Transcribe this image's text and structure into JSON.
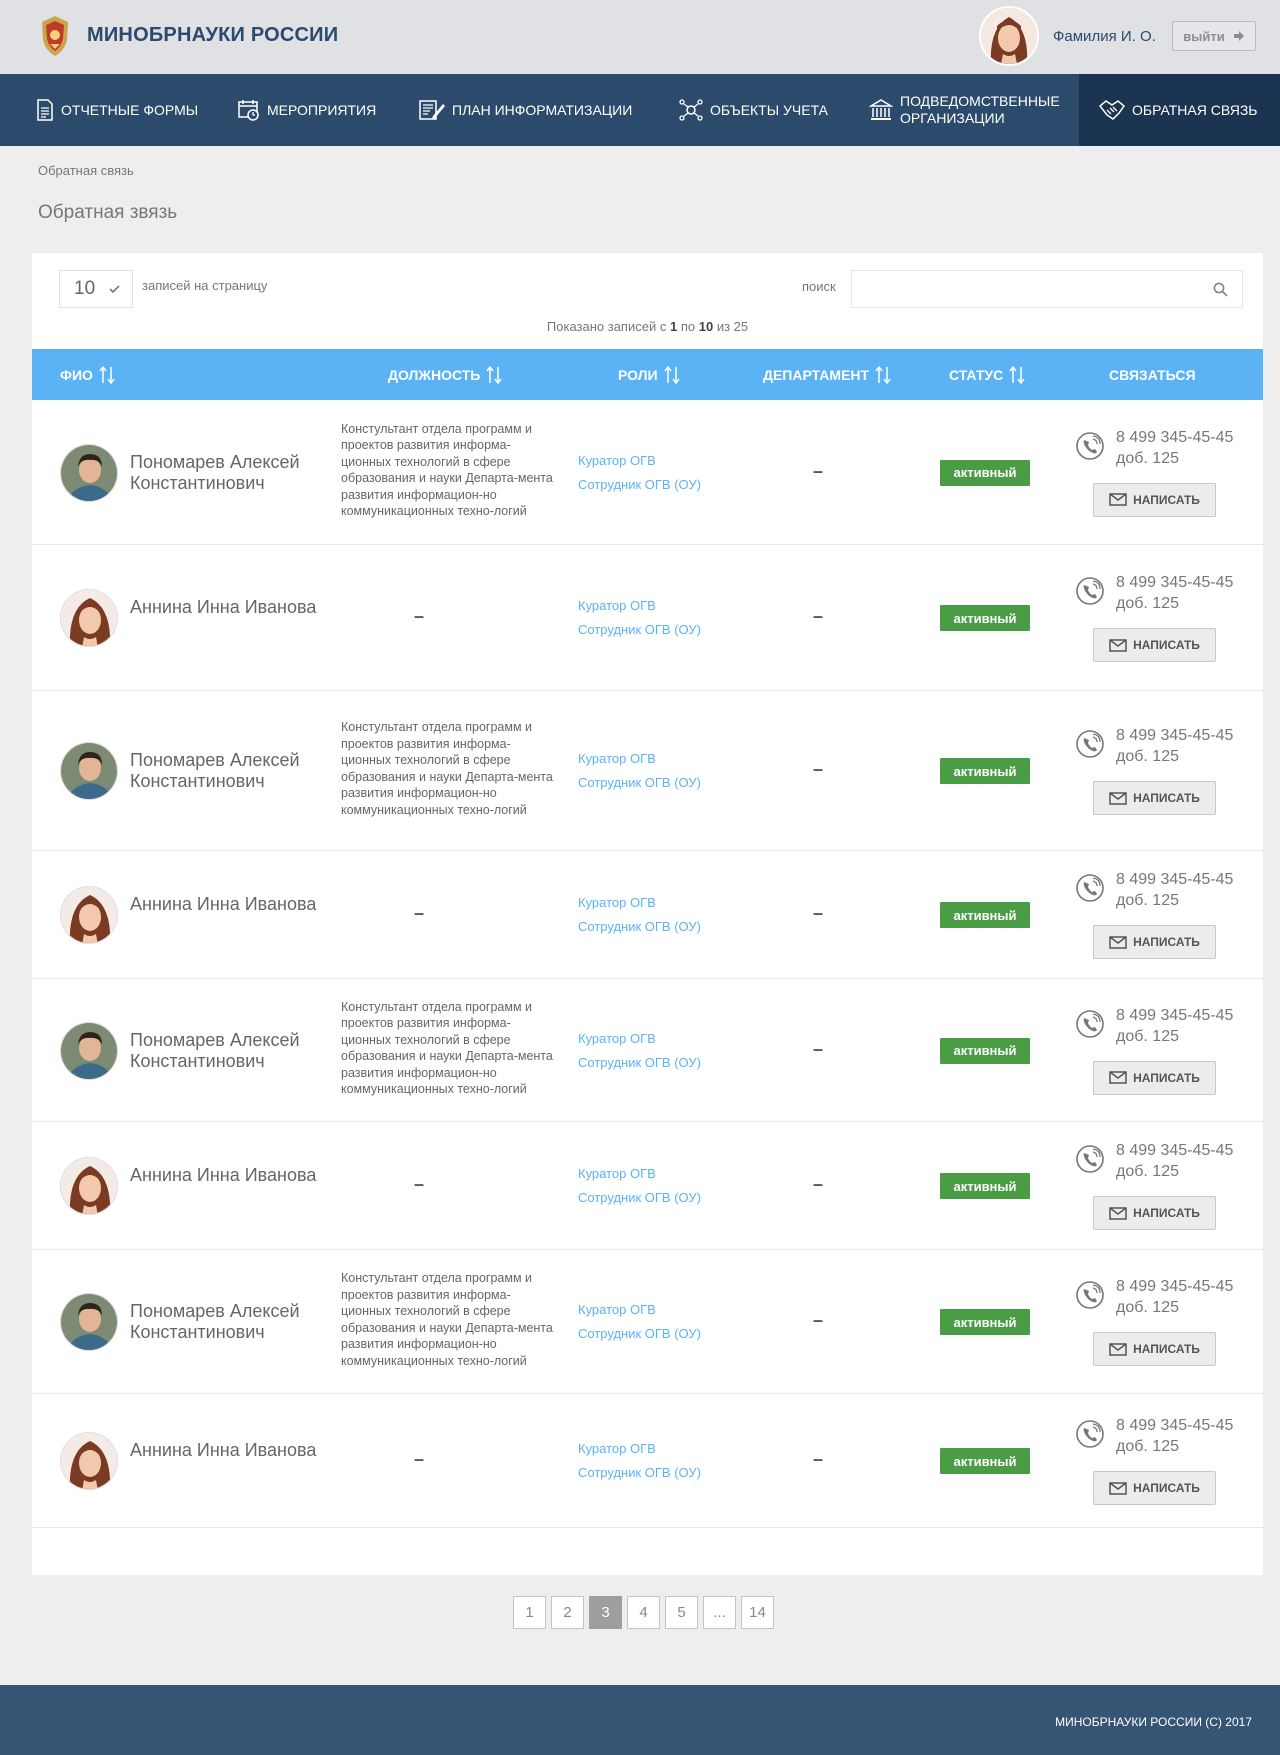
{
  "header": {
    "brand": "МИНОБРНАУКИ РОССИИ",
    "user_name": "Фамилия И. О.",
    "logout_label": "выйти"
  },
  "nav": [
    {
      "label": "ОТЧЕТНЫЕ ФОРМЫ",
      "icon": "document-icon"
    },
    {
      "label": "МЕРОПРИЯТИЯ",
      "icon": "calendar-clock-icon"
    },
    {
      "label": "ПЛАН ИНФОРМАТИЗАЦИИ",
      "icon": "plan-edit-icon"
    },
    {
      "label": "ОБЪЕКТЫ УЧЕТА",
      "icon": "network-icon"
    },
    {
      "label": "ПОДВЕДОМСТВЕННЫЕ ОРГАНИЗАЦИИ",
      "icon": "bank-icon"
    },
    {
      "label": "ОБРАТНАЯ СВЯЗЬ",
      "icon": "handshake-icon",
      "active": true
    }
  ],
  "breadcrumb": "Обратная связь",
  "page_title": "Обратная звязь",
  "table_controls": {
    "per_page": "10",
    "per_page_label": "записей на страницу",
    "search_label": "поиск",
    "search_value": "",
    "shown_prefix": "Показано записей с",
    "shown_from": "1",
    "shown_mid": "по",
    "shown_to": "10",
    "shown_of": "из 25"
  },
  "columns": [
    "ФИО",
    "ДОЛЖНОСТЬ",
    "РОЛИ",
    "ДЕПАРТАМЕНТ",
    "СТАТУС",
    "СВЯЗАТЬСЯ"
  ],
  "rows": [
    {
      "name": "Пономарев Алексей Константинович",
      "gender": "m",
      "position": "Констультант отдела программ и проектов развития информа-ционных технологий в сфере образования и науки Департа-мента развития информацион-но  коммуникационных техно-логий",
      "role1": "Куратор ОГВ",
      "role2": "Сотрудник ОГВ (ОУ)",
      "dept": "–",
      "status": "активный",
      "phone": "8 499 345-45-45",
      "ext": "доб. 125",
      "write": "НАПИСАТЬ"
    },
    {
      "name": "Аннина Инна Иванова",
      "gender": "f",
      "position": "–",
      "role1": "Куратор ОГВ",
      "role2": "Сотрудник ОГВ (ОУ)",
      "dept": "–",
      "status": "активный",
      "phone": "8 499 345-45-45",
      "ext": "доб. 125",
      "write": "НАПИСАТЬ"
    },
    {
      "name": "Пономарев Алексей Константинович",
      "gender": "m",
      "position": "Констультант отдела программ и проектов развития информа-ционных технологий в сфере образования и науки Департа-мента развития информацион-но  коммуникационных техно-логий",
      "role1": "Куратор ОГВ",
      "role2": "Сотрудник ОГВ (ОУ)",
      "dept": "–",
      "status": "активный",
      "phone": "8 499 345-45-45",
      "ext": "доб. 125",
      "write": "НАПИСАТЬ"
    },
    {
      "name": "Аннина Инна Иванова",
      "gender": "f",
      "position": "–",
      "role1": "Куратор ОГВ",
      "role2": "Сотрудник ОГВ (ОУ)",
      "dept": "–",
      "status": "активный",
      "phone": "8 499 345-45-45",
      "ext": "доб. 125",
      "write": "НАПИСАТЬ"
    },
    {
      "name": "Пономарев Алексей Константинович",
      "gender": "m",
      "position": "Констультант отдела программ и проектов развития информа-ционных технологий в сфере образования и науки Департа-мента развития информацион-но  коммуникационных техно-логий",
      "role1": "Куратор ОГВ",
      "role2": "Сотрудник ОГВ (ОУ)",
      "dept": "–",
      "status": "активный",
      "phone": "8 499 345-45-45",
      "ext": "доб. 125",
      "write": "НАПИСАТЬ"
    },
    {
      "name": "Аннина Инна Иванова",
      "gender": "f",
      "position": "–",
      "role1": "Куратор ОГВ",
      "role2": "Сотрудник ОГВ (ОУ)",
      "dept": "–",
      "status": "активный",
      "phone": "8 499 345-45-45",
      "ext": "доб. 125",
      "write": "НАПИСАТЬ"
    },
    {
      "name": "Пономарев Алексей Константинович",
      "gender": "m",
      "position": "Констультант отдела программ и проектов развития информа-ционных технологий в сфере образования и науки Департа-мента развития информацион-но  коммуникационных техно-логий",
      "role1": "Куратор ОГВ",
      "role2": "Сотрудник ОГВ (ОУ)",
      "dept": "–",
      "status": "активный",
      "phone": "8 499 345-45-45",
      "ext": "доб. 125",
      "write": "НАПИСАТЬ"
    },
    {
      "name": "Аннина Инна Иванова",
      "gender": "f",
      "position": "–",
      "role1": "Куратор ОГВ",
      "role2": "Сотрудник ОГВ (ОУ)",
      "dept": "–",
      "status": "активный",
      "phone": "8 499 345-45-45",
      "ext": "доб. 125",
      "write": "НАПИСАТЬ"
    }
  ],
  "pagination": [
    "1",
    "2",
    "3",
    "4",
    "5",
    "...",
    "14"
  ],
  "pagination_active": "3",
  "footer": "МИНОБРНАУКИ РОССИИ  (C) 2017",
  "colors": {
    "header_bg": "#dfe1e5",
    "nav_bg": "#2c4b6c",
    "nav_active": "#1b3451",
    "table_head": "#5bb3f5",
    "status_active": "#4a9d45",
    "footer_bg": "#365575"
  }
}
